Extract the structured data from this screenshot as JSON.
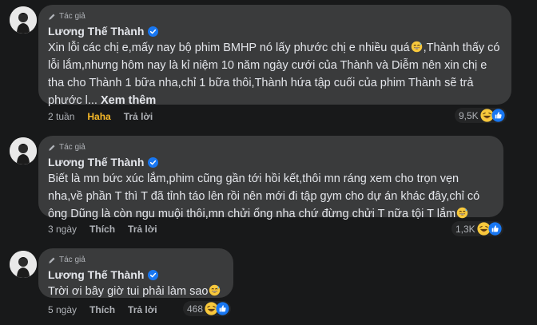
{
  "comments": [
    {
      "author_tag": "Tác giả",
      "name": "Lương Thế Thành",
      "text": "Xin lỗi các chị e,mấy nay bộ phim BMHP nó lấy phước chị e nhiều quá",
      "text2": ",Thành thấy có lỗi lắm,nhưng hôm nay là kỉ niệm 10 năm ngày cưới của Thành và Diễm nên xin chị e tha cho Thành 1 bữa nha,chỉ 1 bữa thôi,Thành hứa tập cuối của phim Thành sẽ trả phước l...",
      "see_more": "Xem thêm",
      "time": "2 tuần",
      "reaction": "Haha",
      "reply": "Trả lời",
      "count": "9,5K"
    },
    {
      "author_tag": "Tác giả",
      "name": "Lương Thế Thành",
      "text": "Biết là mn bức xúc lắm,phim cũng gần tới hồi kết,thôi mn ráng xem cho trọn vẹn nha,về phần T thì T đã tỉnh táo lên rồi nên mới đi tập gym cho dự án khác đây,chỉ có ông Dũng là còn ngu muội thôi,mn chửi ổng nha chứ đừng chửi T nữa tội T lắm",
      "time": "3 ngày",
      "like": "Thích",
      "reply": "Trả lời",
      "count": "1,3K"
    },
    {
      "author_tag": "Tác giả",
      "name": "Lương Thế Thành",
      "text": "Trời ơi bây giờ tui phải làm sao",
      "time": "5 ngày",
      "like": "Thích",
      "reply": "Trả lời",
      "count": "468"
    }
  ],
  "colors": {
    "background": "#18191a",
    "bubble": "#3a3b3c",
    "haha": "#f7b928",
    "verified": "#1877f2"
  },
  "icons": [
    "pencil-icon",
    "verified-icon",
    "grinning-sweat-emoji",
    "haha-reaction-icon",
    "like-reaction-icon"
  ]
}
